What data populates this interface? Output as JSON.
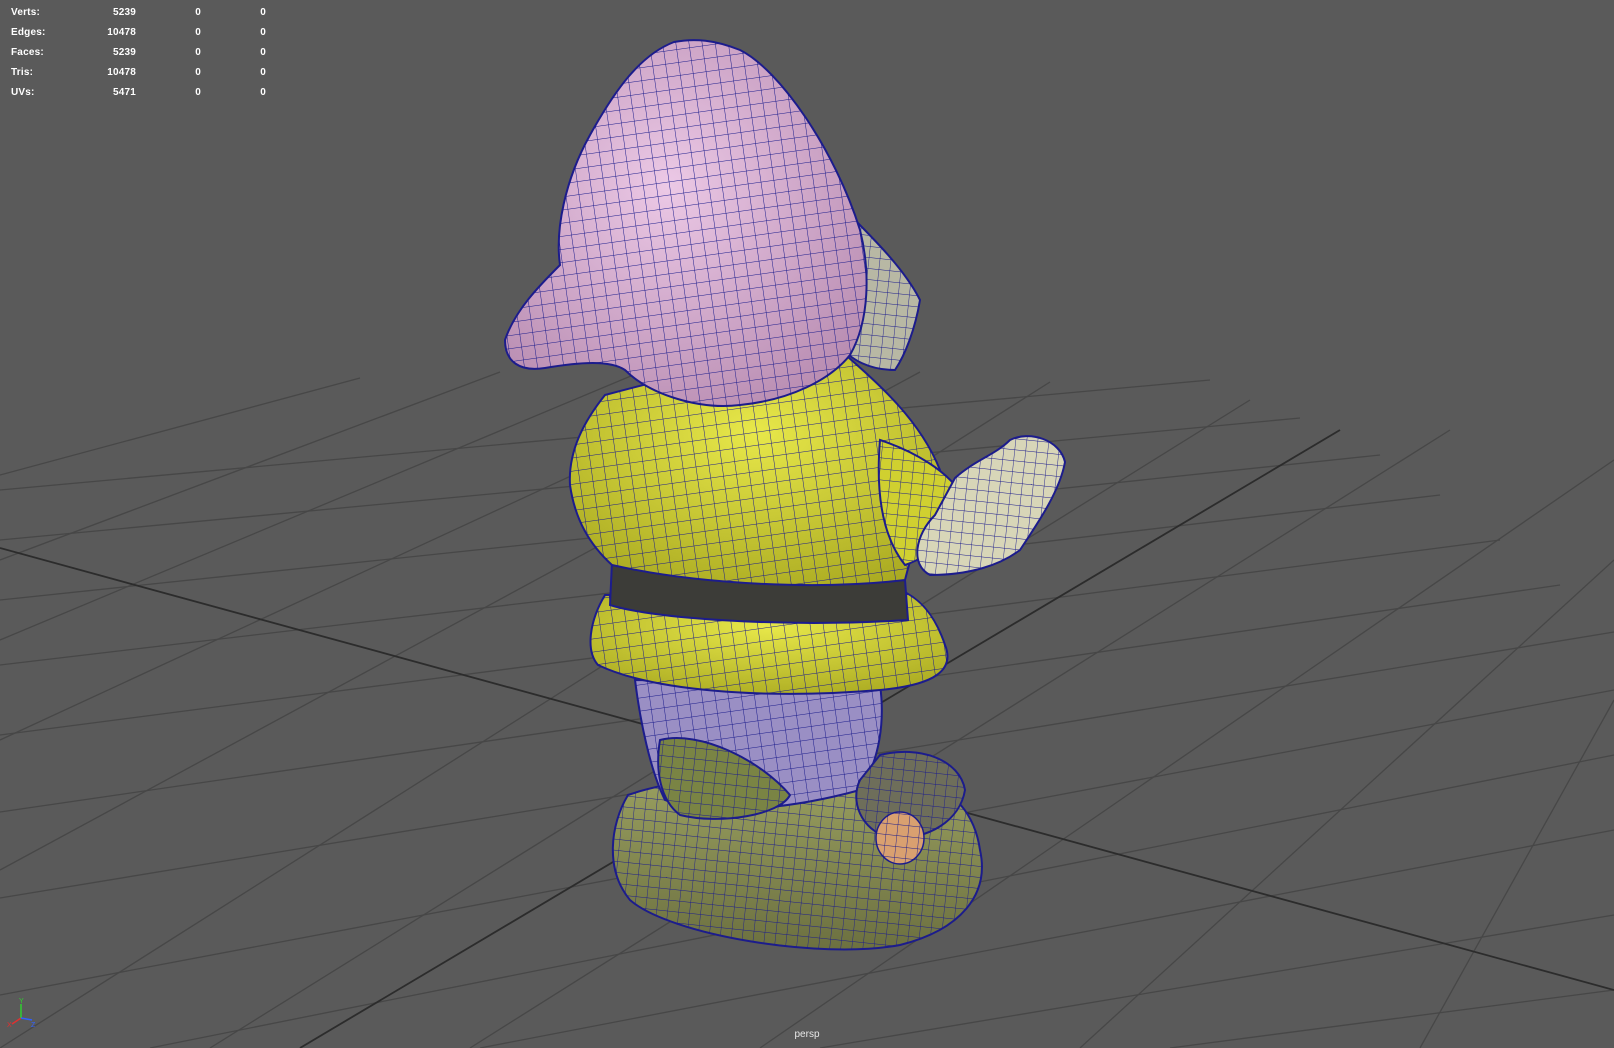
{
  "hud": {
    "rows": [
      {
        "label": "Verts:",
        "v1": "5239",
        "v2": "0",
        "v3": "0"
      },
      {
        "label": "Edges:",
        "v1": "10478",
        "v2": "0",
        "v3": "0"
      },
      {
        "label": "Faces:",
        "v1": "5239",
        "v2": "0",
        "v3": "0"
      },
      {
        "label": "Tris:",
        "v1": "10478",
        "v2": "0",
        "v3": "0"
      },
      {
        "label": "UVs:",
        "v1": "5471",
        "v2": "0",
        "v3": "0"
      }
    ]
  },
  "camera": {
    "name": "persp"
  },
  "axis_gizmo": {
    "labels": {
      "x": "X",
      "y": "Y",
      "z": "Z"
    },
    "colors": {
      "x": "#e03030",
      "y": "#30d030",
      "z": "#3060ff"
    }
  },
  "colors": {
    "background": "#5a5a5a",
    "grid_line": "#474747",
    "grid_axis": "#2a2a2a",
    "wireframe": "#1c1c8c",
    "hat": "#cfa7c9",
    "coat": "#d6d630",
    "trousers": "#9a8fc4",
    "base": "#8f9550",
    "hand": "#d8d6b8"
  }
}
